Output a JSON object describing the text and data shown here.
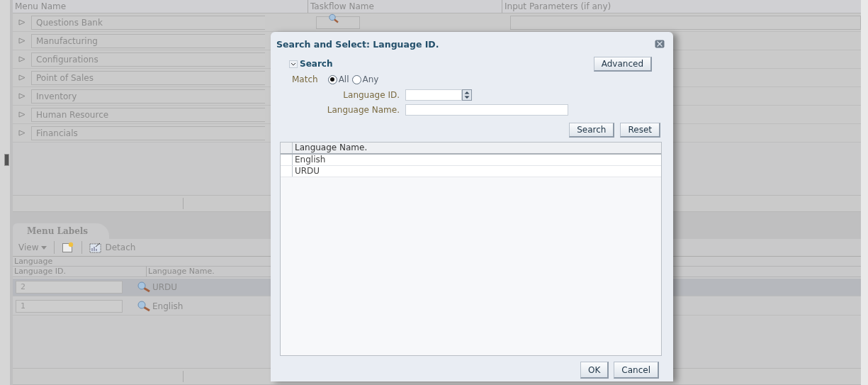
{
  "page": {
    "columns": [
      "Menu Name",
      "Taskflow Name",
      "Input Parameters (if any)"
    ],
    "menu_rows": [
      {
        "label": "Questions Bank",
        "expanded": false
      },
      {
        "label": "Manufacturing",
        "expanded": false
      },
      {
        "label": "Configurations",
        "expanded": false
      },
      {
        "label": "Point of Sales",
        "expanded": false
      },
      {
        "label": "Inventory",
        "expanded": false
      },
      {
        "label": "Human Resource",
        "expanded": false
      },
      {
        "label": "Financials",
        "expanded": false
      }
    ],
    "labels_panel": {
      "tab": "Menu Labels",
      "view": "View",
      "detach": "Detach",
      "group_header": "Language",
      "columns": [
        "Language ID.",
        "Language Name."
      ],
      "rows": [
        {
          "id": "2",
          "name": "URDU",
          "selected": true
        },
        {
          "id": "1",
          "name": "English",
          "selected": false
        }
      ]
    }
  },
  "dialog": {
    "title": "Search and Select: Language ID.",
    "search_section": {
      "title": "Search",
      "expanded": true
    },
    "advanced_button": "Advanced",
    "match": {
      "label": "Match",
      "options": [
        {
          "label": "All",
          "selected": true
        },
        {
          "label": "Any",
          "selected": false
        }
      ]
    },
    "fields": [
      {
        "label": "Language ID.",
        "kind": "spinner"
      },
      {
        "label": "Language Name.",
        "kind": "text"
      }
    ],
    "buttons": [
      "Search",
      "Reset"
    ],
    "results": {
      "columns": [
        "Language Name."
      ],
      "rows": [
        {
          "name": "English"
        },
        {
          "name": "URDU"
        }
      ]
    },
    "footer_buttons": [
      "OK",
      "Cancel"
    ]
  }
}
